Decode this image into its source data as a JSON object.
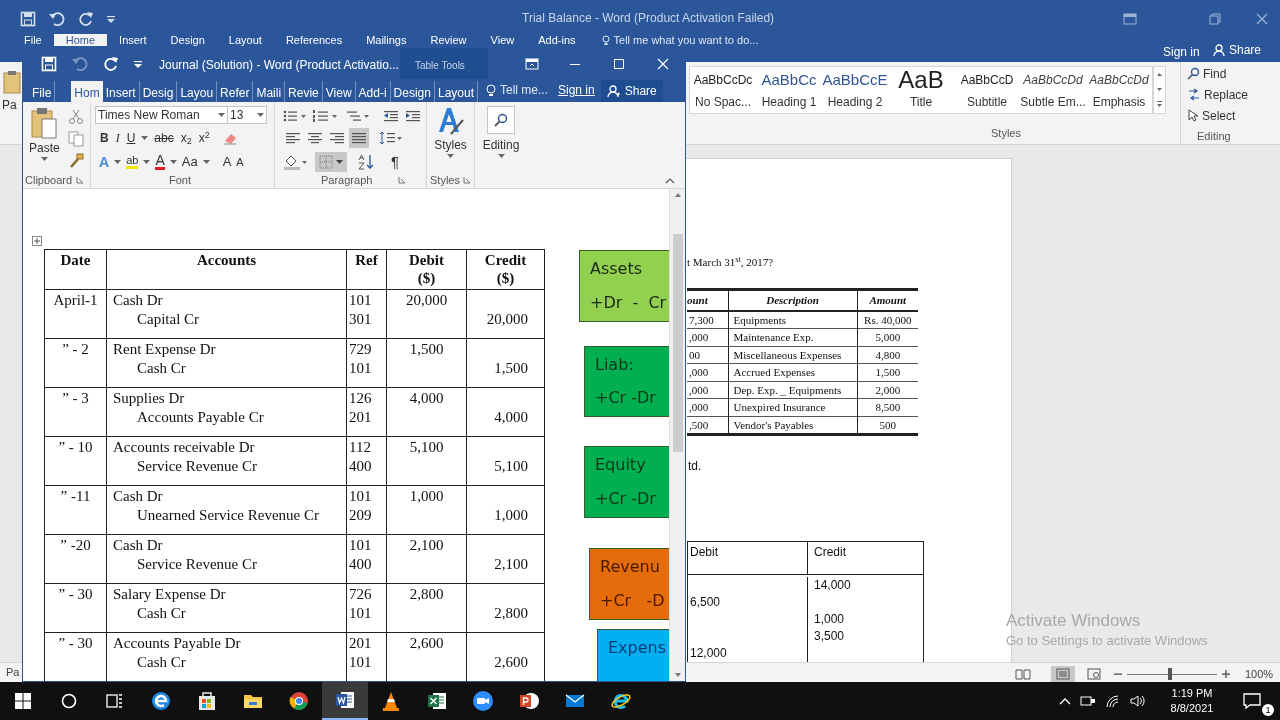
{
  "background_window": {
    "title": "Trial Balance - Word (Product Activation Failed)",
    "tabs": [
      {
        "label": "File",
        "selected": false
      },
      {
        "label": "Home",
        "selected": true
      },
      {
        "label": "Insert",
        "selected": false
      },
      {
        "label": "Design",
        "selected": false
      },
      {
        "label": "Layout",
        "selected": false
      },
      {
        "label": "References",
        "selected": false
      },
      {
        "label": "Mailings",
        "selected": false
      },
      {
        "label": "Review",
        "selected": false
      },
      {
        "label": "View",
        "selected": false
      },
      {
        "label": "Add-ins",
        "selected": false
      }
    ],
    "tell_me": "Tell me what you want to do...",
    "sign_in": "Sign in",
    "share": "Share",
    "clipboard_partial": "Pa",
    "styles_gallery": [
      {
        "preview": "AaBbCcDc",
        "name": "No Spac..."
      },
      {
        "preview": "AaBbCc",
        "name": "Heading 1"
      },
      {
        "preview": "AaBbCcE",
        "name": "Heading 2"
      },
      {
        "preview": "AaB",
        "name": "Title"
      },
      {
        "preview": "AaBbCcD",
        "name": "Subtitle"
      },
      {
        "preview": "AaBbCcDd",
        "name": "Subtle Em..."
      },
      {
        "preview": "AaBbCcDd",
        "name": "Emphasis"
      }
    ],
    "styles_label": "Styles",
    "editing": {
      "find": "Find",
      "replace": "Replace",
      "select": "Select",
      "label": "Editing"
    },
    "document": {
      "heading": "t March 31$^{st}$, 2017?",
      "balances_table": {
        "columns": [
          "ount",
          "Description",
          "Amount"
        ],
        "rows": [
          {
            "amount_left": "7,300",
            "description": "Equipments",
            "amount": "Rs. 40,000"
          },
          {
            "amount_left": ",000",
            "description": "Maintenance Exp.",
            "amount": "5,000"
          },
          {
            "amount_left": "00",
            "description": "Miscellaneous Expenses",
            "amount": "4,800"
          },
          {
            "amount_left": ",000",
            "description": "Accrued Expenses",
            "amount": "1,500"
          },
          {
            "amount_left": ",000",
            "description": "Dep. Exp. _ Equipments",
            "amount": "2,000"
          },
          {
            "amount_left": ",000",
            "description": "Unexpired Insurance",
            "amount": "8,500"
          },
          {
            "amount_left": ",500",
            "description": "Vendor's Payables",
            "amount": "500"
          }
        ]
      },
      "note": "td.",
      "trial_table": {
        "columns": [
          "Debit",
          "Credit"
        ],
        "lines": [
          {
            "credit": "14,000"
          },
          {
            "debit": "6,500"
          },
          {
            "credit": "1,000"
          },
          {
            "credit": "3,500"
          },
          {
            "debit": "12,000"
          }
        ]
      }
    },
    "status_bar": {
      "page_partial": "Pa",
      "zoom": "100%",
      "zoom_slider": {
        "level": 0.48
      }
    }
  },
  "activation_notice": {
    "title": "Activate Windows",
    "message": "Go to Settings to activate Windows"
  },
  "foreground_window": {
    "title": "Journal (Solution) - Word (Product Activatio...",
    "context_label": "Table Tools",
    "tabs": [
      {
        "label": "File",
        "selected": false
      },
      {
        "label": "Hom",
        "selected": true
      },
      {
        "label": "Insert",
        "selected": false
      },
      {
        "label": "Desig",
        "selected": false
      },
      {
        "label": "Layou",
        "selected": false
      },
      {
        "label": "Refer",
        "selected": false
      },
      {
        "label": "Maili",
        "selected": false
      },
      {
        "label": "Revie",
        "selected": false
      },
      {
        "label": "View",
        "selected": false
      },
      {
        "label": "Add-i",
        "selected": false
      },
      {
        "label": "Design",
        "selected": false
      },
      {
        "label": "Layout",
        "selected": false
      }
    ],
    "tell_me": "Tell me...",
    "sign_in": "Sign in",
    "share": "Share",
    "ribbon": {
      "paste": "Paste",
      "clipboard_label": "Clipboard",
      "font_name": "Times New Roman",
      "font_size": "13",
      "format_buttons": [
        "B",
        "I",
        "U",
        "abc",
        "x$_{2}$",
        "x$^{2}$"
      ],
      "effect_buttons": [
        "A",
        "ab",
        "A",
        "Aa",
        "A",
        "A"
      ],
      "font_label": "Font",
      "alignments": [
        {
          "kind": "left",
          "selected": false
        },
        {
          "kind": "center",
          "selected": false
        },
        {
          "kind": "right",
          "selected": false
        },
        {
          "kind": "justify",
          "selected": true
        }
      ],
      "pilcrow": "¶",
      "paragraph_label": "Paragraph",
      "styles_button": "Styles",
      "styles_label": "Styles",
      "editing_button": "Editing"
    },
    "journal": {
      "columns": [
        {
          "label": "Date"
        },
        {
          "label": "Accounts"
        },
        {
          "label": "Ref"
        },
        {
          "label": "Debit",
          "unit": "($)"
        },
        {
          "label": "Credit",
          "unit": "($)"
        }
      ],
      "rows": [
        {
          "date": "April-1",
          "debit": {
            "account": "Cash Dr",
            "ref": "101",
            "amount": "20,000"
          },
          "credit": {
            "account": "Capital Cr",
            "ref": "301",
            "amount": "20,000"
          }
        },
        {
          "date": "” - 2",
          "debit": {
            "account": "Rent Expense Dr",
            "ref": "729",
            "amount": "1,500"
          },
          "credit": {
            "account": "Cash Cr",
            "ref": "101",
            "amount": "1,500"
          }
        },
        {
          "date": "” - 3",
          "debit": {
            "account": "Supplies Dr",
            "ref": "126",
            "amount": "4,000"
          },
          "credit": {
            "account": "Accounts Payable Cr",
            "ref": "201",
            "amount": "4,000"
          }
        },
        {
          "date": "” - 10",
          "debit": {
            "account": "Accounts receivable Dr",
            "ref": "112",
            "amount": "5,100"
          },
          "credit": {
            "account": "Service Revenue Cr",
            "ref": "400",
            "amount": "5,100"
          }
        },
        {
          "date": "” -11",
          "debit": {
            "account": "Cash Dr",
            "ref": "101",
            "amount": "1,000"
          },
          "credit": {
            "account": "Unearned Service Revenue Cr",
            "ref": "209",
            "amount": "1,000"
          }
        },
        {
          "date": "” -20",
          "debit": {
            "account": "Cash Dr",
            "ref": "101",
            "amount": "2,100"
          },
          "credit": {
            "account": "Service Revenue Cr",
            "ref": "400",
            "amount": "2,100"
          }
        },
        {
          "date": "” - 30",
          "debit": {
            "account": "Salary Expense Dr",
            "ref": "726",
            "amount": "2,800"
          },
          "credit": {
            "account": "Cash Cr",
            "ref": "101",
            "amount": "2,800"
          }
        },
        {
          "date": "” - 30",
          "debit": {
            "account": "Accounts Payable Dr",
            "ref": "201",
            "amount": "2,600"
          },
          "credit": {
            "account": "Cash Cr",
            "ref": "101",
            "amount": "2,600"
          }
        }
      ]
    },
    "category_boxes": [
      {
        "title": "Assets",
        "rule": "+Dr  -  Cr",
        "color": "#92d050"
      },
      {
        "title": "Liab:",
        "rule": "+Cr -Dr",
        "color": "#00b050"
      },
      {
        "title": "Equity",
        "rule": "+Cr -Dr",
        "color": "#00b050"
      },
      {
        "title": "Revenu",
        "rule": "+Cr   -D",
        "color": "#e46c0a"
      },
      {
        "title": "Expens",
        "color": "#00b0f0"
      }
    ]
  },
  "taskbar": {
    "apps": [
      {
        "kind": "browser_e",
        "selected": false
      },
      {
        "kind": "store",
        "selected": false
      },
      {
        "kind": "folder",
        "selected": false
      },
      {
        "kind": "browser_ring",
        "selected": false
      },
      {
        "kind": "word",
        "selected": true
      },
      {
        "kind": "cone",
        "selected": false
      },
      {
        "kind": "excel",
        "selected": false
      },
      {
        "kind": "camera",
        "selected": false
      },
      {
        "kind": "slides",
        "selected": false
      },
      {
        "kind": "mail",
        "selected": false
      },
      {
        "kind": "browser_ie",
        "selected": false
      }
    ],
    "time": "1:19 PM",
    "date": "8/8/2021",
    "notifications": "1"
  }
}
